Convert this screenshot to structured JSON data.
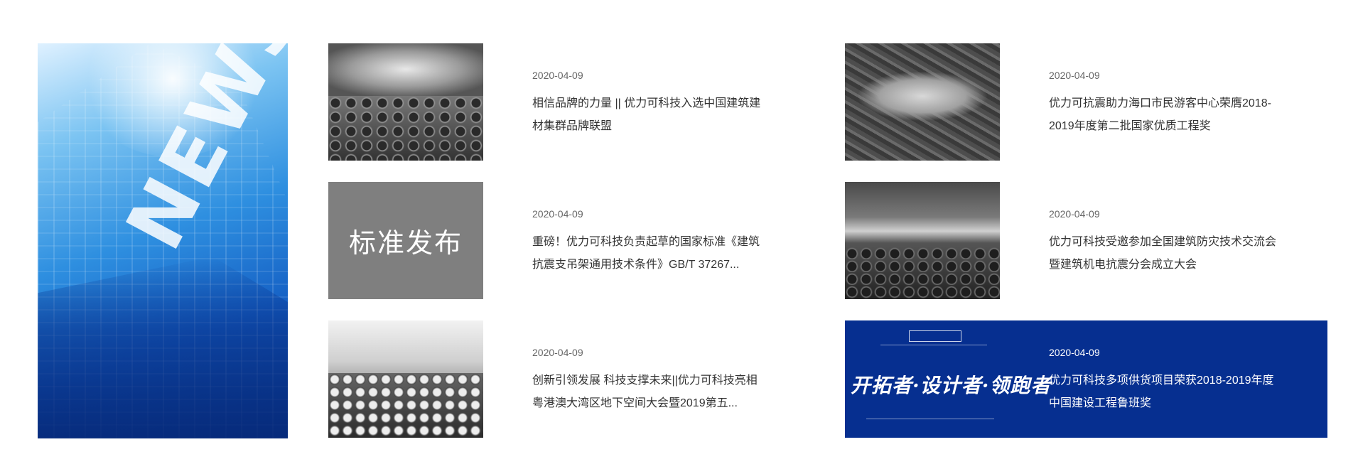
{
  "hero": {
    "word": "NEWS"
  },
  "news": [
    {
      "date": "2020-04-09",
      "title": "相信品牌的力量 || 优力可科技入选中国建筑建材集群品牌联盟"
    },
    {
      "date": "2020-04-09",
      "title": "重磅！优力可科技负责起草的国家标准《建筑抗震支吊架通用技术条件》GB/T 37267...",
      "tile_text": "标准发布"
    },
    {
      "date": "2020-04-09",
      "title": "创新引领发展 科技支撑未来||优力可科技亮相粤港澳大湾区地下空间大会暨2019第五..."
    },
    {
      "date": "2020-04-09",
      "title": "优力可抗震助力海口市民游客中心荣膺2018-2019年度第二批国家优质工程奖"
    },
    {
      "date": "2020-04-09",
      "title": "优力可科技受邀参加全国建筑防灾技术交流会暨建筑机电抗震分会成立大会"
    },
    {
      "date": "2020-04-09",
      "title": "优力可科技多项供货项目荣获2018-2019年度中国建设工程鲁班奖",
      "banner_slogan": "开拓者·设计者·领跑者"
    }
  ],
  "colors": {
    "featured_bg": "#062f90",
    "gray_tile": "#7f7f7f"
  }
}
